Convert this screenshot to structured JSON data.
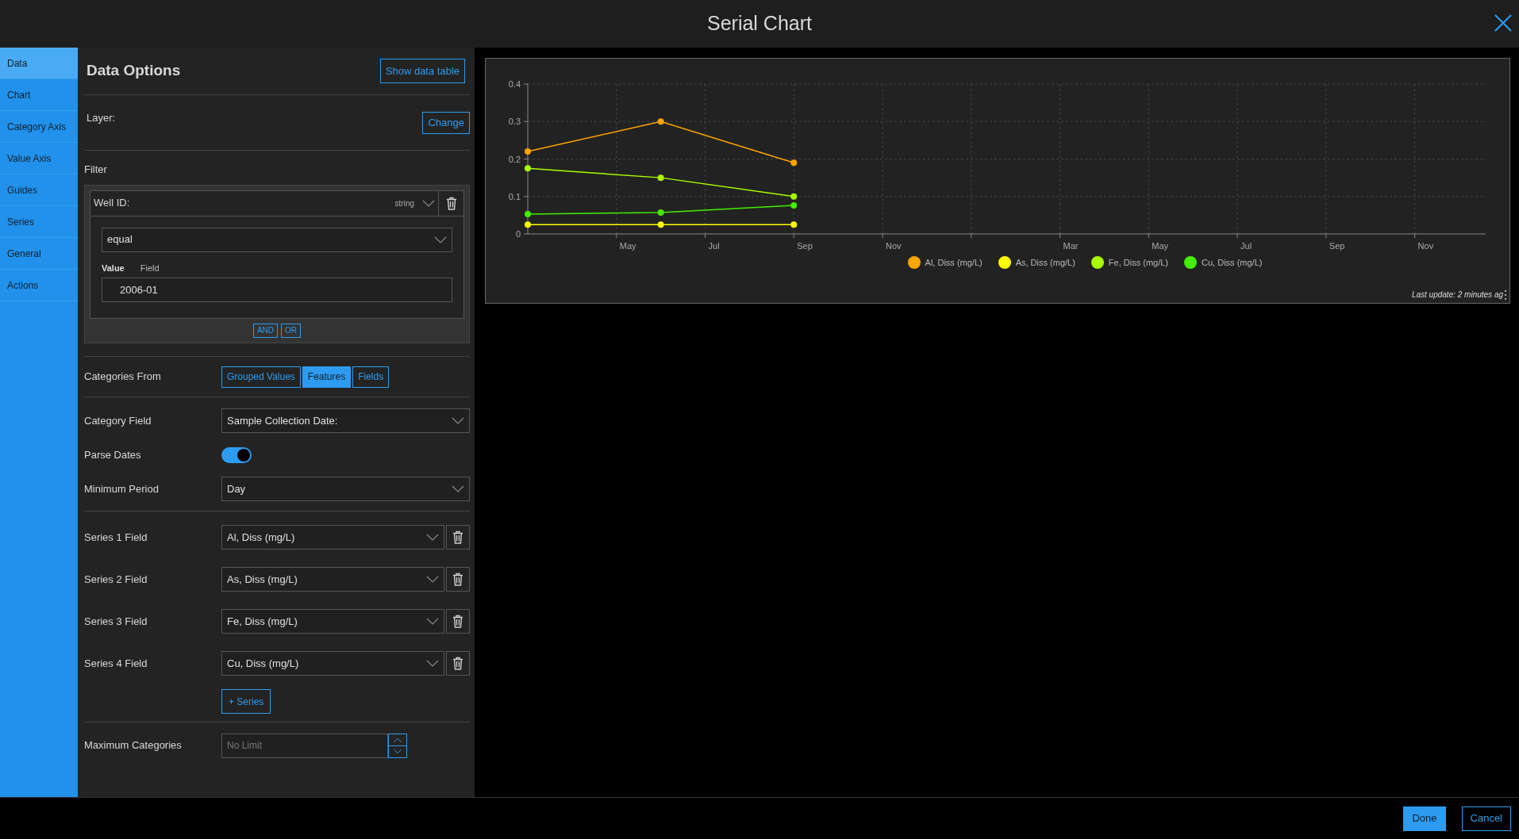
{
  "window": {
    "title": "Serial Chart"
  },
  "nav": [
    {
      "label": "Data",
      "selected": true
    },
    {
      "label": "Chart",
      "selected": false
    },
    {
      "label": "Category Axis",
      "selected": false
    },
    {
      "label": "Value Axis",
      "selected": false
    },
    {
      "label": "Guides",
      "selected": false
    },
    {
      "label": "Series",
      "selected": false
    },
    {
      "label": "General",
      "selected": false
    },
    {
      "label": "Actions",
      "selected": false
    }
  ],
  "data_options": {
    "title": "Data Options",
    "show_table_button": "Show data table",
    "layer_label": "Layer:",
    "change_button": "Change",
    "filter": {
      "label": "Filter",
      "field": "Well ID:",
      "type": "string",
      "operator": "equal",
      "value_tabs": [
        {
          "label": "Value",
          "selected": true
        },
        {
          "label": "Field",
          "selected": false
        }
      ],
      "value": "2006-01",
      "joins": [
        "AND",
        "OR"
      ]
    },
    "categories_from": {
      "label": "Categories From",
      "options": [
        {
          "label": "Grouped Values",
          "selected": false
        },
        {
          "label": "Features",
          "selected": true
        },
        {
          "label": "Fields",
          "selected": false
        }
      ]
    },
    "category_field": {
      "label": "Category Field",
      "value": "Sample Collection Date:"
    },
    "parse_dates": {
      "label": "Parse Dates",
      "on": true
    },
    "minimum_period": {
      "label": "Minimum Period",
      "value": "Day"
    },
    "series": [
      {
        "label": "Series 1 Field",
        "value": "Al, Diss (mg/L)"
      },
      {
        "label": "Series 2 Field",
        "value": "As, Diss (mg/L)"
      },
      {
        "label": "Series 3 Field",
        "value": "Fe, Diss (mg/L)"
      },
      {
        "label": "Series 4 Field",
        "value": "Cu, Diss (mg/L)"
      }
    ],
    "add_series_button": "+ Series",
    "maximum_categories": {
      "label": "Maximum Categories",
      "placeholder": "No Limit"
    }
  },
  "chart": {
    "chart_data": {
      "type": "line",
      "grid": true,
      "categories": [
        null,
        null,
        "May",
        null,
        "Jul",
        null,
        "Sep",
        null,
        "Nov",
        null,
        null,
        null,
        "Mar",
        null,
        "May",
        null,
        "Jul",
        null,
        "Sep",
        null,
        "Nov",
        null
      ],
      "ylim": [
        0,
        0.4
      ],
      "yticks": [
        0,
        0.1,
        0.2,
        0.3,
        0.4
      ],
      "series": [
        {
          "name": "Al, Diss (mg/L)",
          "color": "#ffa500",
          "marker": "circle",
          "values": [
            0.22,
            null,
            null,
            0.3,
            null,
            null,
            0.19,
            null,
            null,
            null,
            null,
            null,
            null,
            null,
            null,
            null,
            null,
            null,
            null,
            null,
            null,
            null
          ]
        },
        {
          "name": "As, Diss (mg/L)",
          "color": "#ffff00",
          "marker": "circle",
          "values": [
            0.025,
            null,
            null,
            0.025,
            null,
            null,
            0.025,
            null,
            null,
            null,
            null,
            null,
            null,
            null,
            null,
            null,
            null,
            null,
            null,
            null,
            null,
            null
          ]
        },
        {
          "name": "Fe, Diss (mg/L)",
          "color": "#aaff00",
          "marker": "circle",
          "values": [
            0.175,
            null,
            null,
            0.15,
            null,
            null,
            0.1,
            null,
            null,
            null,
            null,
            null,
            null,
            null,
            null,
            null,
            null,
            null,
            null,
            null,
            null,
            null
          ]
        },
        {
          "name": "Cu, Diss (mg/L)",
          "color": "#44ee00",
          "marker": "circle",
          "values": [
            0.053,
            null,
            null,
            0.057,
            null,
            null,
            0.076,
            null,
            null,
            null,
            null,
            null,
            null,
            null,
            null,
            null,
            null,
            null,
            null,
            null,
            null,
            null
          ]
        }
      ]
    },
    "last_update": "Last update: 2 minutes ag"
  },
  "footer": {
    "buttons": [
      {
        "label": "Done",
        "kind": "primary"
      },
      {
        "label": "Cancel",
        "kind": "secondary"
      }
    ]
  }
}
